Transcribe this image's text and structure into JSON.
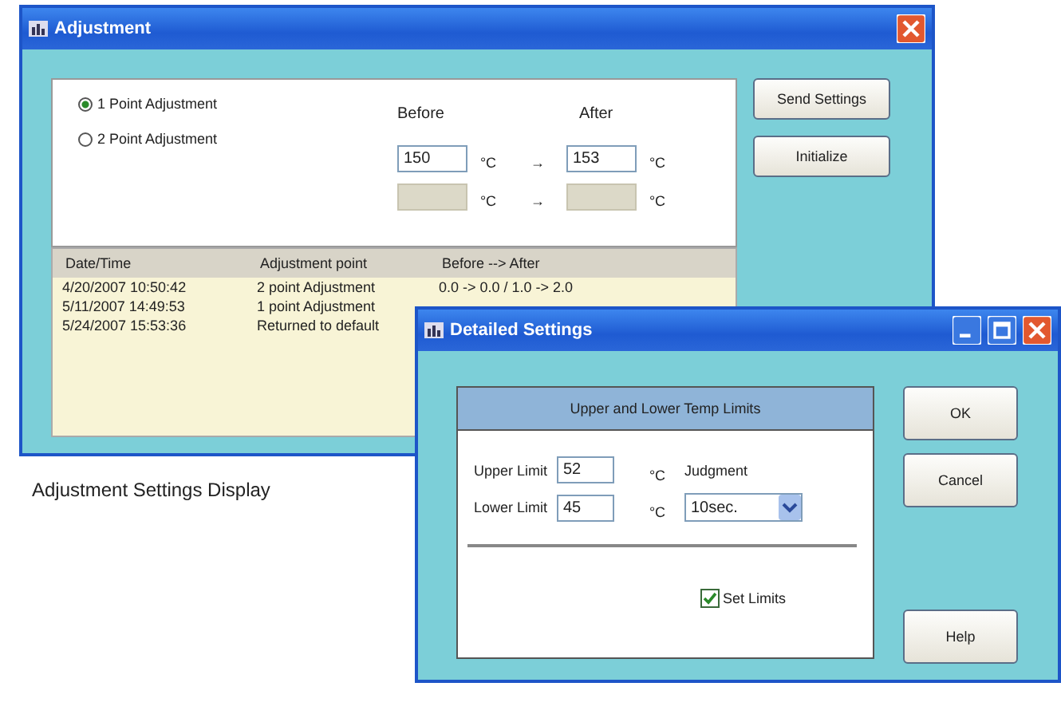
{
  "adjustment_window": {
    "title": "Adjustment",
    "modes": [
      {
        "label": "1 Point Adjustment",
        "selected": true
      },
      {
        "label": "2 Point Adjustment",
        "selected": false
      }
    ],
    "before_label": "Before",
    "after_label": "After",
    "value_rows": [
      {
        "before": "150",
        "before_unit": "°C",
        "arrow": "→",
        "after": "153",
        "after_unit": "°C",
        "disabled": false
      },
      {
        "before_unit": "°C",
        "arrow": "→",
        "after_unit": "°C",
        "disabled": true
      }
    ],
    "buttons": [
      "Send Settings",
      "Initialize"
    ],
    "log": {
      "columns": [
        "Date/Time",
        "Adjustment point",
        "Before --> After"
      ],
      "rows": [
        [
          "4/20/2007 10:50:42",
          "2 point Adjustment",
          "0.0 -> 0.0 / 1.0 -> 2.0"
        ],
        [
          "5/11/2007 14:49:53",
          "1 point Adjustment"
        ],
        [
          "5/24/2007 15:53:36",
          "Returned to default"
        ]
      ]
    }
  },
  "caption": "Adjustment Settings Display",
  "detailed_window": {
    "title": "Detailed Settings",
    "group_title": "Upper and Lower Temp Limits",
    "upper": {
      "label": "Upper Limit",
      "value": "52",
      "unit": "°C"
    },
    "judgment_label": "Judgment",
    "lower": {
      "label": "Lower Limit",
      "value": "45",
      "unit": "°C"
    },
    "judgment_value": "10sec.",
    "set_limits": {
      "label": "Set Limits",
      "checked": true
    },
    "buttons": [
      "OK",
      "Cancel",
      "Help"
    ]
  }
}
